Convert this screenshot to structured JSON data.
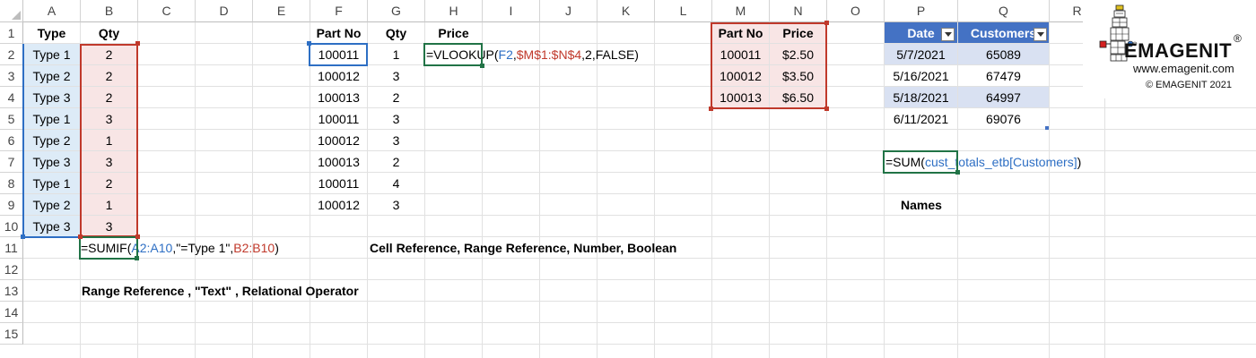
{
  "columns": [
    "A",
    "B",
    "C",
    "D",
    "E",
    "F",
    "G",
    "H",
    "I",
    "J",
    "K",
    "L",
    "M",
    "N",
    "O",
    "P",
    "Q",
    "R"
  ],
  "rows": [
    "1",
    "2",
    "3",
    "4",
    "5",
    "6",
    "7",
    "8",
    "9",
    "10",
    "11",
    "12",
    "13",
    "14",
    "15"
  ],
  "table_a": {
    "headers": [
      "Type",
      "Qty"
    ],
    "rows": [
      [
        "Type 1",
        "2"
      ],
      [
        "Type 2",
        "2"
      ],
      [
        "Type 3",
        "2"
      ],
      [
        "Type 1",
        "3"
      ],
      [
        "Type 2",
        "1"
      ],
      [
        "Type 3",
        "3"
      ],
      [
        "Type 1",
        "2"
      ],
      [
        "Type 2",
        "1"
      ],
      [
        "Type 3",
        "3"
      ]
    ]
  },
  "sumif_formula": {
    "parts": [
      "=SUMIF(",
      "A2:A10",
      ",\"=Type 1\",",
      "B2:B10",
      ")"
    ]
  },
  "label_row13": "Range Reference , \"Text\" , Relational Operator",
  "table_f": {
    "headers": [
      "Part No",
      "Qty",
      "Price"
    ],
    "rows": [
      [
        "100011",
        "1"
      ],
      [
        "100012",
        "3"
      ],
      [
        "100013",
        "2"
      ],
      [
        "100011",
        "3"
      ],
      [
        "100012",
        "3"
      ],
      [
        "100013",
        "2"
      ],
      [
        "100011",
        "4"
      ],
      [
        "100012",
        "3"
      ]
    ]
  },
  "vlookup_formula": {
    "parts": [
      "=VLOOKUP(",
      "F2",
      ",",
      "$M$1:$N$4",
      ",2,FALSE)"
    ]
  },
  "label_row11": "Cell Reference, Range Reference, Number, Boolean",
  "table_m": {
    "headers": [
      "Part No",
      "Price"
    ],
    "rows": [
      [
        "100011",
        "$2.50"
      ],
      [
        "100012",
        "$3.50"
      ],
      [
        "100013",
        "$6.50"
      ]
    ]
  },
  "table_p": {
    "headers": [
      "Date",
      "Customers"
    ],
    "rows": [
      [
        "5/7/2021",
        "65089"
      ],
      [
        "5/16/2021",
        "67479"
      ],
      [
        "5/18/2021",
        "64997"
      ],
      [
        "6/11/2021",
        "69076"
      ]
    ]
  },
  "sum_formula": {
    "parts": [
      "=SUM(",
      "cust_totals_etb[Customers]",
      ")"
    ]
  },
  "names_label": "Names",
  "logo": {
    "brand": "EMAGENIT",
    "registered": "®",
    "url": "www.emagenit.com",
    "copyright": "© EMAGENIT  2021"
  },
  "colors": {
    "blue_ref": "#2e6fc4",
    "red_ref": "#c0392b",
    "green_active": "#217346",
    "table_header": "#4472c4"
  }
}
